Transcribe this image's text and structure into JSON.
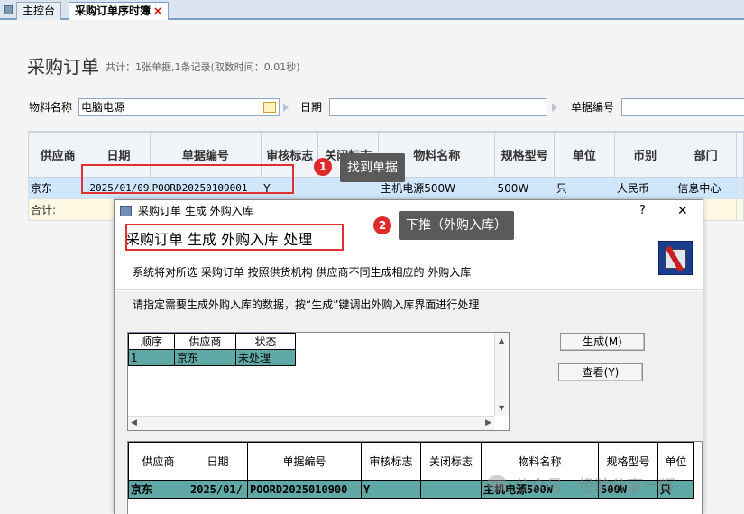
{
  "tabs": [
    {
      "label": "主控台"
    },
    {
      "label": "采购订单序时簿"
    }
  ],
  "tab_close": "×",
  "page": {
    "title": "采购订单",
    "subtitle": "共计：1张单据,1条记录(取数时间：0.01秒)"
  },
  "filters": {
    "material_label": "物料名称",
    "material_value": "电脑电源",
    "date_label": "日期",
    "date_value": "",
    "billno_label": "单据编号",
    "billno_value": ""
  },
  "main_grid": {
    "headers": [
      "供应商",
      "日期",
      "单据编号",
      "审核标志",
      "关闭标志",
      "物料名称",
      "规格型号",
      "单位",
      "币别",
      "部门"
    ],
    "row": [
      "京东",
      "2025/01/09",
      "POORD20250109001",
      "Y",
      "",
      "主机电源500W",
      "500W",
      "只",
      "人民币",
      "信息中心"
    ],
    "sum_label": "合计:"
  },
  "annotations": [
    {
      "num": "1",
      "text": "找到单据"
    },
    {
      "num": "2",
      "text": "下推（外购入库）"
    }
  ],
  "dialog": {
    "title": "采购订单 生成 外购入库",
    "help": "?",
    "close": "✕",
    "heading": "采购订单 生成 外购入库 处理",
    "description": "系统将对所选 采购订单 按照供货机构 供应商不同生成相应的 外购入库",
    "instruction": "请指定需要生成外购入库的数据，按“生成”键调出外购入库界面进行处理",
    "sub_grid": {
      "headers": [
        "顺序",
        "供应商",
        "状态"
      ],
      "row": [
        "1",
        "京东",
        "未处理"
      ]
    },
    "buttons": {
      "generate": "生成(M)",
      "view": "查看(Y)"
    },
    "bottom_grid": {
      "headers": [
        "供应商",
        "日期",
        "单据编号",
        "审核标志",
        "关闭标志",
        "物料名称",
        "规格型号",
        "单位"
      ],
      "row": [
        "京东",
        "2025/01/",
        "POORD2025010900",
        "Y",
        "",
        "主机电源500W",
        "500W",
        "只"
      ]
    }
  },
  "watermark": "公众号 · 经验分享一辉",
  "colors": {
    "selected_row": "#cfe6fb",
    "teal_row": "#5fa8a6",
    "annotation_red": "#e03030",
    "tag_bg": "#5a5a5a"
  }
}
